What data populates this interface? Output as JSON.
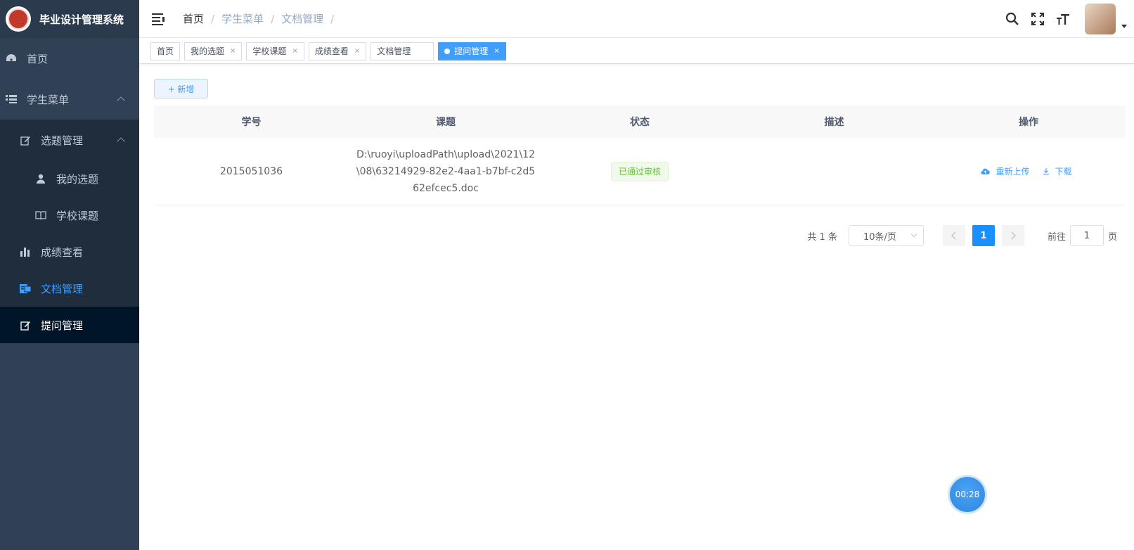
{
  "app": {
    "title": "毕业设计管理系统"
  },
  "sidebar": {
    "items": [
      {
        "label": "首页",
        "icon": "dashboard-icon"
      },
      {
        "label": "学生菜单",
        "icon": "list-icon"
      },
      {
        "label": "选题管理",
        "icon": "edit-icon"
      },
      {
        "label": "我的选题",
        "icon": "user-icon"
      },
      {
        "label": "学校课题",
        "icon": "book-icon"
      },
      {
        "label": "成绩查看",
        "icon": "bar-chart-icon"
      },
      {
        "label": "文档管理",
        "icon": "document-icon"
      },
      {
        "label": "提问管理",
        "icon": "edit-icon"
      }
    ]
  },
  "breadcrumb": [
    "首页",
    "学生菜单",
    "文档管理"
  ],
  "tags": [
    "首页",
    "我的选题",
    "学校课题",
    "成绩查看",
    "文档管理",
    "提问管理"
  ],
  "toolbar": {
    "add_label": "+ 新增"
  },
  "table": {
    "headers": [
      "学号",
      "课题",
      "状态",
      "描述",
      "操作"
    ],
    "rows": [
      {
        "id": "2015051036",
        "topic": "D:\\ruoyi\\uploadPath\\upload\\2021\\12\\08\\63214929-82e2-4aa1-b7bf-c2d562efcec5.doc",
        "status": "已通过审核",
        "desc": "",
        "reupload": "重新上传",
        "download": "下载"
      }
    ]
  },
  "pagination": {
    "total": "共 1 条",
    "page_size": "10条/页",
    "current": "1",
    "goto_label": "前往",
    "goto_value": "1",
    "page_suffix": "页"
  },
  "timer": "00:28",
  "colors": {
    "sidebar": "#304156",
    "accent": "#409eff",
    "success": "#67c23a"
  }
}
